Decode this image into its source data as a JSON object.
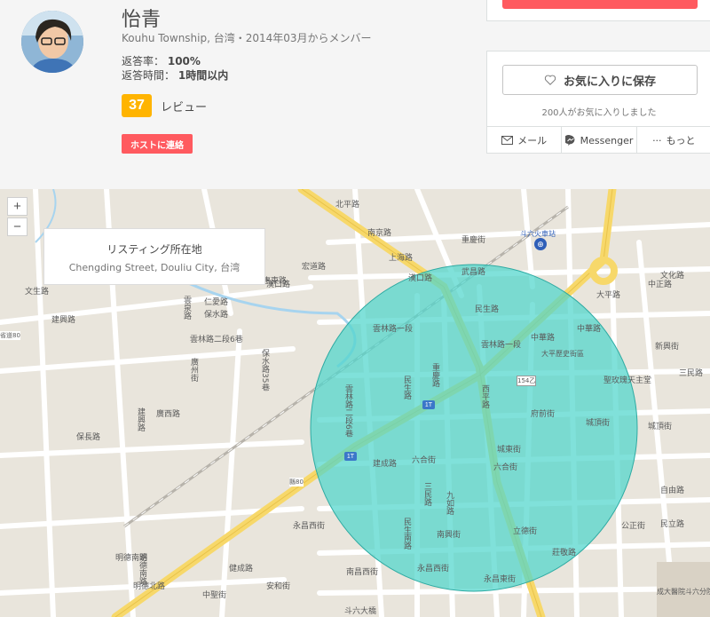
{
  "host": {
    "name": "怡青",
    "subtitle": "Kouhu Township, 台湾・2014年03月からメンバー",
    "response_rate_label": "返答率：",
    "response_rate": "100%",
    "response_time_label": "返答時間：",
    "response_time": "1時間以内",
    "review_count": "37",
    "review_label": "レビュー",
    "contact_label": "ホストに連絡"
  },
  "save_card": {
    "save_label": "お気に入りに保存",
    "save_count": "200人がお気に入りしました",
    "share": [
      {
        "label": "メール",
        "icon": "mail-icon"
      },
      {
        "label": "Messenger",
        "icon": "messenger-icon"
      },
      {
        "label": "もっと",
        "icon": "more-icon",
        "prefix": "···"
      }
    ]
  },
  "map": {
    "zoom_in": "+",
    "zoom_out": "−",
    "info_title": "リスティング所在地",
    "info_address": "Chengding Street, Douliu City, 台湾",
    "circle_color": "#4fd6cc",
    "route_shield_label": "1T",
    "station_label": "斗六火車站",
    "labels_h": [
      "北平路",
      "南京路",
      "上海路",
      "武昌路",
      "漢口路",
      "民生路",
      "中正路",
      "大平路",
      "文化路",
      "中華路",
      "新興街",
      "三民路",
      "聖玫瑰天主堂",
      "城頂街",
      "城頂街",
      "自由路",
      "民立路",
      "公正街",
      "成大醫院斗六分院",
      "建興路",
      "雲林路二段6巷",
      "廣西路",
      "仁愛路",
      "保長路",
      "建成路",
      "文生路",
      "六合街",
      "漢口路",
      "雲林路一段",
      "大平歷史街區",
      "府前街",
      "城東街",
      "六合街",
      "明德北路",
      "南興街",
      "南昌西街",
      "永昌西街",
      "永昌東街",
      "立德街",
      "莊敬路",
      "永昌西街",
      "健成路",
      "安和街",
      "中聖街",
      "中華路",
      "斗六大橋",
      "省道80",
      "縣80",
      "154乙",
      "宏道路",
      "惠東路",
      "保水路",
      "雲林路一段",
      "重慶街",
      "明德南路"
    ],
    "labels_v": [
      "民生路",
      "民生南路",
      "三民路",
      "九如路",
      "西平路",
      "重慶路",
      "保水路35巷",
      "雲林路二段6巷",
      "廣州街",
      "雲泉路",
      "建興路",
      "明德南路"
    ]
  }
}
